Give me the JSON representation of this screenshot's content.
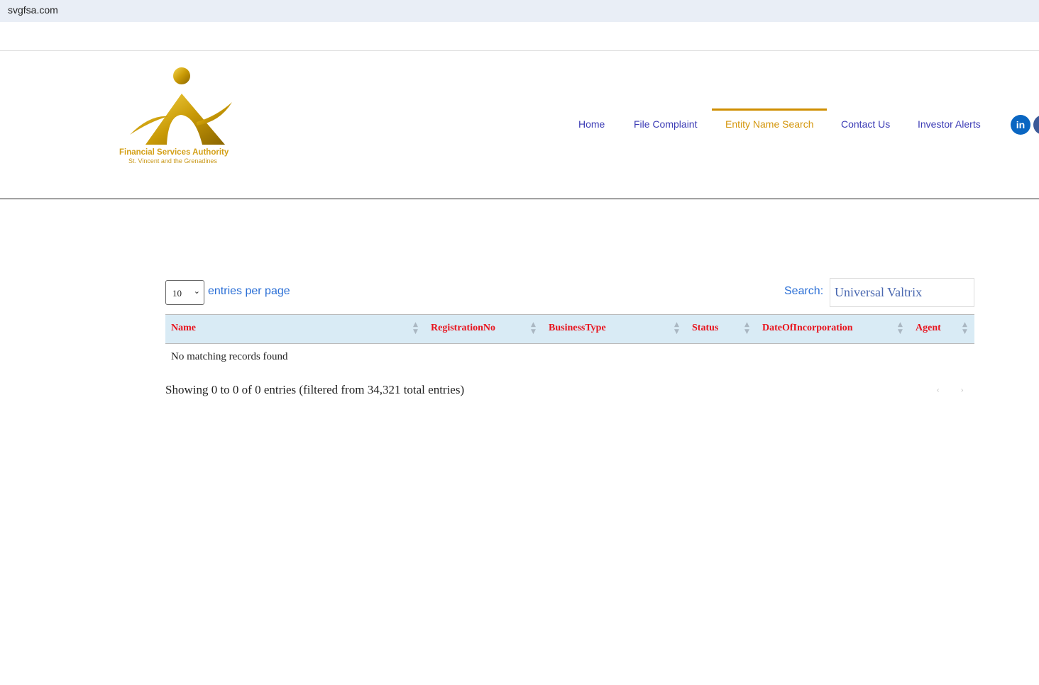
{
  "browser": {
    "url": "svgfsa.com"
  },
  "logo": {
    "line1": "Financial Services Authority",
    "line2": "St. Vincent and the Grenadines"
  },
  "nav": {
    "items": [
      {
        "label": "Home"
      },
      {
        "label": "File Complaint"
      },
      {
        "label": "Entity Name Search",
        "active": true
      },
      {
        "label": "Contact Us"
      },
      {
        "label": "Investor Alerts"
      }
    ],
    "social": [
      {
        "icon": "linkedin-icon",
        "label": "in",
        "color": "#0a66c2"
      },
      {
        "icon": "facebook-icon",
        "color": "#3b5998"
      }
    ]
  },
  "table_controls": {
    "page_size": "10",
    "entries_label": "entries per page",
    "search_label": "Search:",
    "search_value": "Universal Valtrix"
  },
  "table": {
    "columns": [
      "Name",
      "RegistrationNo",
      "BusinessType",
      "Status",
      "DateOfIncorporation",
      "Agent"
    ],
    "empty_message": "No matching records found"
  },
  "footer": {
    "info": "Showing 0 to 0 of 0 entries (filtered from 34,321 total entries)",
    "prev": "‹",
    "next": "›"
  }
}
